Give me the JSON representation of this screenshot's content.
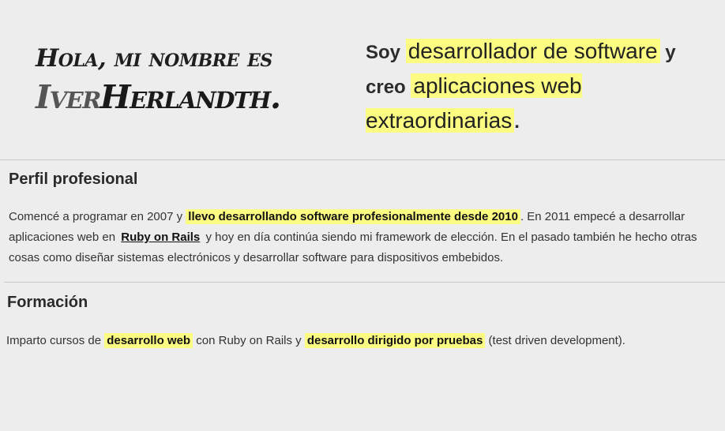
{
  "hero": {
    "greeting": "Hola, mi nombre es",
    "first_name": "Iver",
    "last_name": "Herlandth.",
    "tagline": {
      "pre1": "Soy ",
      "hl1": "desarrollador de software",
      "mid": " y creo ",
      "hl2": "aplicaciones web extraordinarias",
      "end": "."
    }
  },
  "profile": {
    "title": "Perfil profesional",
    "t1": "Comencé a programar en 2007 y ",
    "hl1": "llevo desarrollando software profesionalmente desde 2010",
    "t2": ". En 2011 empecé a desarrollar aplicaciones web en ",
    "link": "Ruby on Rails",
    "t3": " y hoy en día continúa siendo mi framework de elección. En el pasado también he hecho otras cosas como diseñar sistemas electrónicos y desarrollar software para dispositivos embebidos."
  },
  "training": {
    "title": "Formación",
    "t1": "Imparto cursos de ",
    "hl1": "desarrollo web",
    "t2": " con Ruby on Rails y ",
    "hl2": "desarrollo dirigido por pruebas",
    "t3": " (test driven development)."
  }
}
